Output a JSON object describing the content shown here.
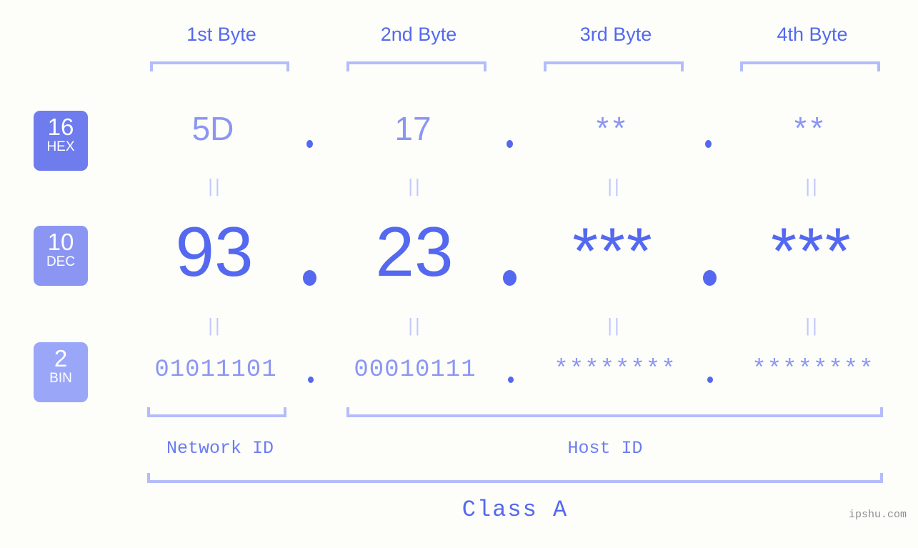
{
  "meta": {
    "watermark": "ipshu.com",
    "background_color": "#fdfefa",
    "accent_strong": "#5468f0",
    "accent_mid": "#8b96f2",
    "accent_light": "#b4bcfb"
  },
  "byte_headers": [
    {
      "label": "1st Byte"
    },
    {
      "label": "2nd Byte"
    },
    {
      "label": "3rd Byte"
    },
    {
      "label": "4th Byte"
    }
  ],
  "radix_badges": [
    {
      "number": "16",
      "name": "HEX",
      "color": "#6e7ced"
    },
    {
      "number": "10",
      "name": "DEC",
      "color": "#8b96f2"
    },
    {
      "number": "2",
      "name": "BIN",
      "color": "#9aa6f7"
    }
  ],
  "rows": {
    "hex": {
      "values": [
        "5D",
        "17",
        "**",
        "**"
      ],
      "separator": "."
    },
    "dec": {
      "values": [
        "93",
        "23",
        "***",
        "***"
      ],
      "separator": "."
    },
    "bin": {
      "values": [
        "01011101",
        "00010111",
        "********",
        "********"
      ],
      "separator": "."
    }
  },
  "equals_marks": {
    "glyph": "||",
    "count_per_row": 4
  },
  "segments": {
    "network_id": "Network ID",
    "host_id": "Host ID",
    "class": "Class A"
  }
}
